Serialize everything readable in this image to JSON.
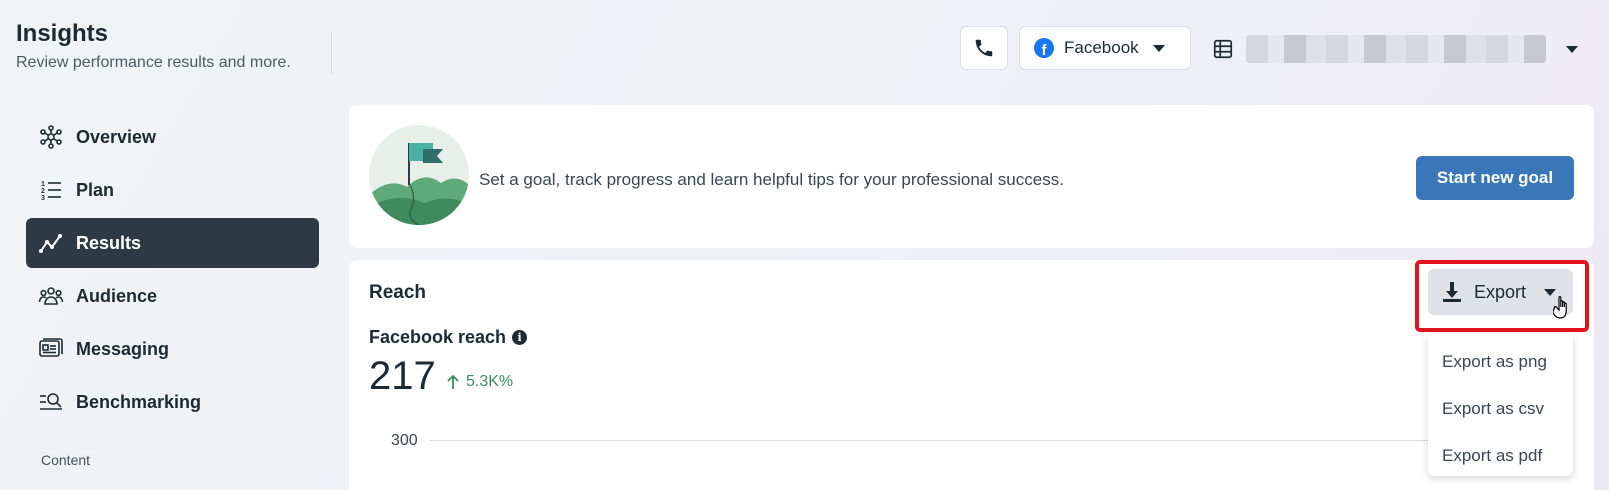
{
  "header": {
    "title": "Insights",
    "subtitle": "Review performance results and more.",
    "platform_label": "Facebook"
  },
  "sidebar": {
    "items": [
      {
        "label": "Overview",
        "icon": "overview-icon",
        "active": false
      },
      {
        "label": "Plan",
        "icon": "plan-list-icon",
        "active": false
      },
      {
        "label": "Results",
        "icon": "results-trend-icon",
        "active": true
      },
      {
        "label": "Audience",
        "icon": "audience-icon",
        "active": false
      },
      {
        "label": "Messaging",
        "icon": "messaging-icon",
        "active": false
      },
      {
        "label": "Benchmarking",
        "icon": "benchmarking-icon",
        "active": false
      }
    ],
    "section_label": "Content"
  },
  "goal_card": {
    "text": "Set a goal, track progress and learn helpful tips for your professional success.",
    "button_label": "Start new goal"
  },
  "reach": {
    "title": "Reach",
    "metric_label": "Facebook reach",
    "value": "217",
    "delta": "5.3K%",
    "axis_tick": "300"
  },
  "export": {
    "button_label": "Export",
    "menu": [
      "Export as png",
      "Export as csv",
      "Export as pdf"
    ]
  },
  "colors": {
    "active_nav": "#2d3a45",
    "primary_button": "#3a77b8",
    "delta_positive": "#3f8a5f",
    "highlight": "#e3131c",
    "facebook_blue": "#1877f2"
  }
}
